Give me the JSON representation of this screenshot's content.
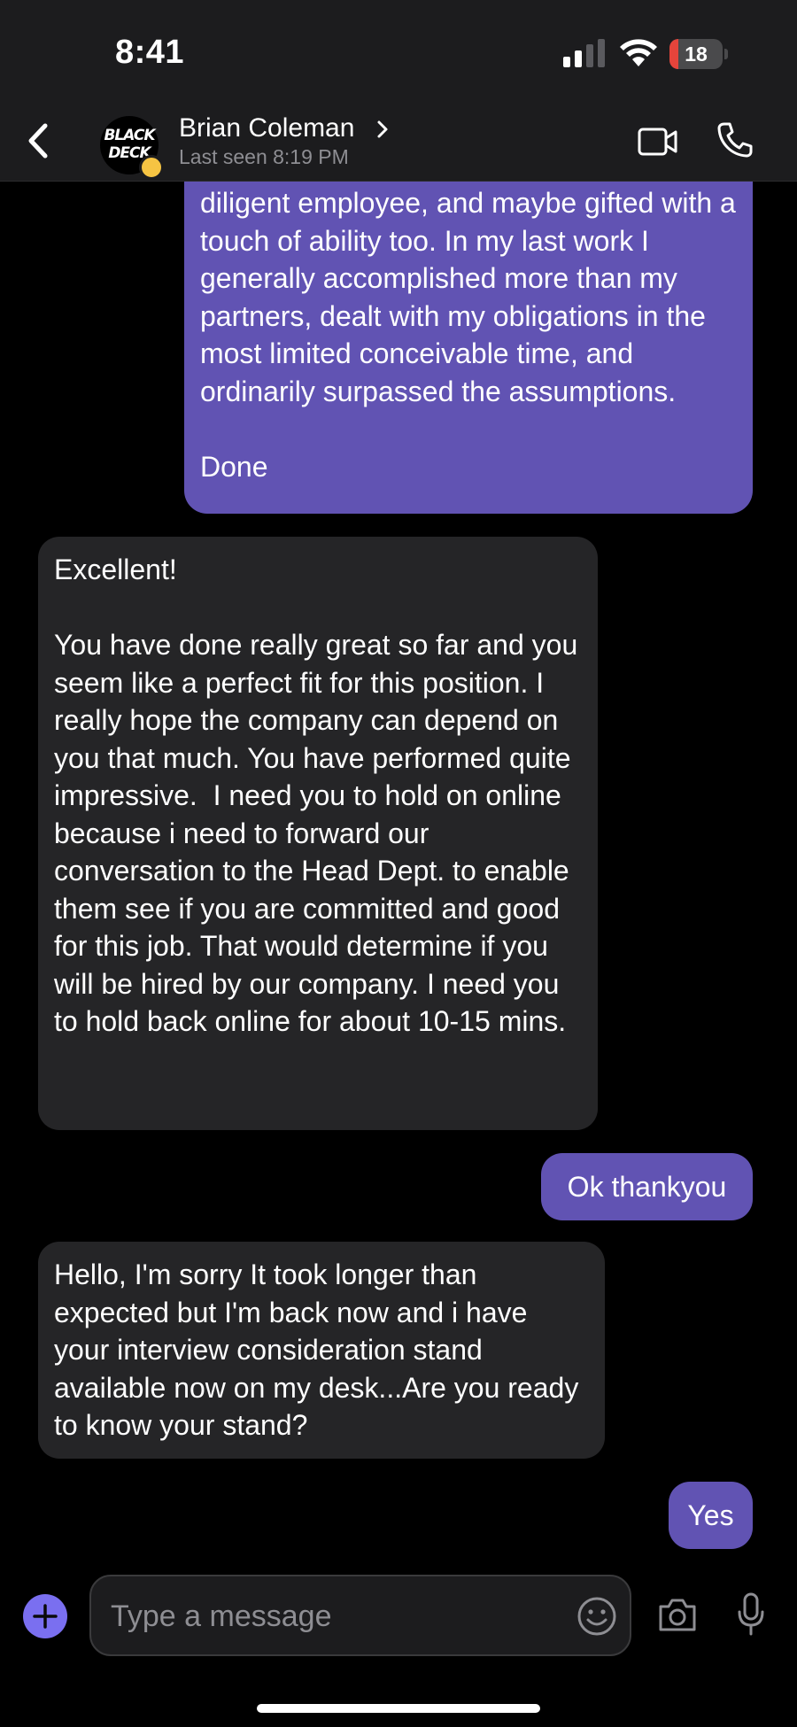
{
  "status_bar": {
    "time": "8:41",
    "battery_level": "18",
    "battery_color": "#e5443b"
  },
  "header": {
    "avatar_text_line1": "BLACK",
    "avatar_text_line2": "DECK",
    "contact_name": "Brian Coleman",
    "last_seen": "Last seen 8:19 PM"
  },
  "messages": [
    {
      "direction": "outgoing",
      "text": "diligent employee, and maybe gifted with a touch of ability too. In my last work I generally accomplished more than my partners, dealt with my obligations in the most limited conceivable time, and ordinarily surpassed the assumptions.\n\nDone"
    },
    {
      "direction": "incoming",
      "text": "Excellent!\n\nYou have done really great so far and you seem like a perfect fit for this position. I really hope the company can depend on you that much. You have performed quite impressive.  I need you to hold on online because i need to forward our conversation to the Head Dept. to enable them see if you are committed and good for this job. That would determine if you will be hired by our company. I need you to hold back online for about 10-15 mins."
    },
    {
      "direction": "outgoing",
      "text": "Ok thankyou"
    },
    {
      "direction": "incoming",
      "text": "Hello, I'm sorry It took longer than expected but I'm back now and i have your interview consideration stand available now on my desk...Are you ready to know your stand?"
    },
    {
      "direction": "outgoing",
      "text": "Yes"
    }
  ],
  "composer": {
    "placeholder": "Type a message"
  },
  "colors": {
    "outgoing_bubble": "#6153b3",
    "incoming_bubble": "#252527",
    "accent": "#7a6ff0"
  }
}
